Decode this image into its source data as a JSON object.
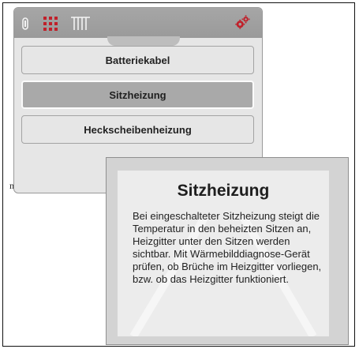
{
  "sidebar": {
    "edge_char": "n"
  },
  "toolbar": {
    "icons": [
      "tube-icon",
      "heater-grid-icon",
      "columns-icon",
      "settings-gears-icon"
    ],
    "accent_color": "#c0202a"
  },
  "buttons": [
    {
      "label": "Batteriekabel",
      "selected": false
    },
    {
      "label": "Sitzheizung",
      "selected": true
    },
    {
      "label": "Heckscheibenheizung",
      "selected": false
    }
  ],
  "tooltip": {
    "title": "Sitzheizung",
    "body": "Bei eingeschalteter Sitzheizung steigt die Temperatur in den beheizten Sitzen an, Heizgitter unter den Sitzen werden sichtbar. Mit Wärmebilddiagnose-Gerät prüfen, ob Brüche im Heizgitter vorliegen, bzw. ob das Heizgitter funktioniert."
  }
}
